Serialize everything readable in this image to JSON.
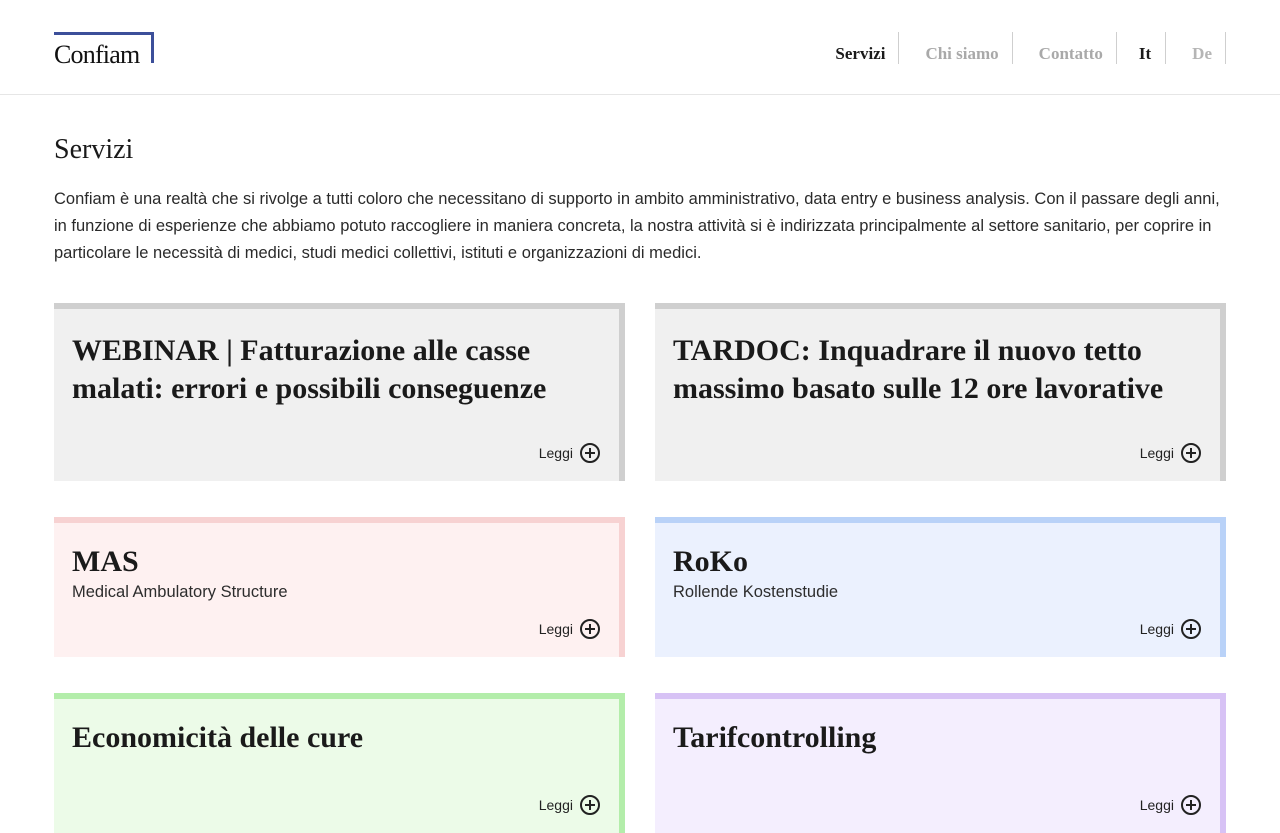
{
  "header": {
    "logo_text": "Confiam",
    "nav": [
      "Servizi",
      "Chi siamo",
      "Contatto"
    ],
    "languages": [
      "It",
      "De"
    ]
  },
  "page": {
    "title": "Servizi",
    "intro": "Confiam è una realtà che si rivolge a tutti coloro che necessitano di supporto in ambito amministrativo, data entry e business analysis. Con il passare degli anni, in funzione di esperienze che abbiamo potuto raccogliere in maniera concreta, la nostra attività si è indirizzata principalmente al settore sanitario, per coprire in particolare le necessità di medici, studi medici collettivi, istituti e organizzazioni di medici."
  },
  "cards": [
    {
      "title": "WEBINAR | Fatturazione alle casse malati: errori e possibili conseguenze",
      "subtitle": "",
      "read_label": "Leggi",
      "color": "#cfcfcf"
    },
    {
      "title": "TARDOC: Inquadrare il nuovo tetto massimo basato sulle 12 ore lavorative",
      "subtitle": "",
      "read_label": "Leggi",
      "color": "#cfcfcf"
    },
    {
      "title": "MAS",
      "subtitle": "Medical Ambulatory Structure",
      "read_label": "Leggi",
      "color": "#f7d2d2"
    },
    {
      "title": "RoKo",
      "subtitle": "Rollende Kostenstudie",
      "read_label": "Leggi",
      "color": "#b9d2f8"
    },
    {
      "title": "Economicità delle cure",
      "subtitle": "",
      "read_label": "Leggi",
      "color": "#b3edaa"
    },
    {
      "title": "Tarifcontrolling",
      "subtitle": "",
      "read_label": "Leggi",
      "color": "#d7c2f5"
    }
  ],
  "colors": {
    "logo_accent": "#3c4f9a"
  }
}
